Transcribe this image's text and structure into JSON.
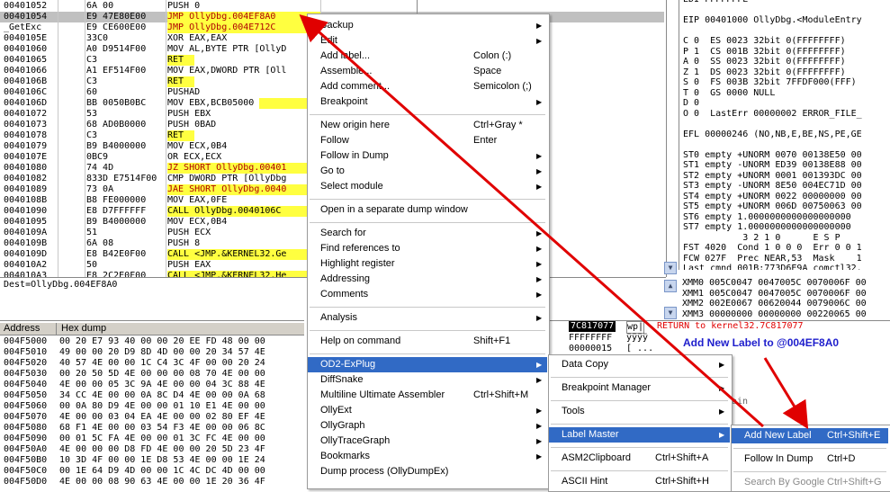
{
  "disasm": {
    "rows": [
      {
        "addr": "00401052",
        "hex": "6A 00",
        "cmd": "PUSH 0",
        "style": ""
      },
      {
        "addr": "00401054",
        "hex": "E9 47E80E00",
        "cmd": "JMP OllyDbg.004EF8A0",
        "style": "jmp-sel"
      },
      {
        "addr": "_GetExc",
        "hex": "E9 CE600E00",
        "cmd": "JMP OllyDbg.004E712C",
        "style": "jmp"
      },
      {
        "addr": "0040105E",
        "hex": "33C0",
        "cmd": "XOR EAX,EAX",
        "style": ""
      },
      {
        "addr": "00401060",
        "hex": "A0 D9514F00",
        "cmd": "MOV AL,BYTE PTR [OllyD",
        "style": ""
      },
      {
        "addr": "00401065",
        "hex": "C3",
        "cmd": "RET",
        "style": "ret"
      },
      {
        "addr": "00401066",
        "hex": "A1 EF514F00",
        "cmd": "MOV EAX,DWORD PTR [Oll",
        "style": ""
      },
      {
        "addr": "0040106B",
        "hex": "C3",
        "cmd": "RET",
        "style": "ret"
      },
      {
        "addr": "0040106C",
        "hex": "60",
        "cmd": "PUSHAD",
        "style": ""
      },
      {
        "addr": "0040106D",
        "hex": "BB 0050B0BC",
        "cmd": "MOV EBX,BCB05000",
        "style": "movhl"
      },
      {
        "addr": "00401072",
        "hex": "53",
        "cmd": "PUSH EBX",
        "style": ""
      },
      {
        "addr": "00401073",
        "hex": "68 AD0B0000",
        "cmd": "PUSH 0BAD",
        "style": ""
      },
      {
        "addr": "00401078",
        "hex": "C3",
        "cmd": "RET",
        "style": "ret"
      },
      {
        "addr": "00401079",
        "hex": "B9 B4000000",
        "cmd": "MOV ECX,0B4",
        "style": ""
      },
      {
        "addr": "0040107E",
        "hex": "0BC9",
        "cmd": "OR ECX,ECX",
        "style": ""
      },
      {
        "addr": "00401080",
        "hex": "74 4D",
        "cmd": "JZ SHORT OllyDbg.00401",
        "style": "jmp"
      },
      {
        "addr": "00401082",
        "hex": "833D E7514F00",
        "cmd": "CMP DWORD PTR [OllyDbg",
        "style": ""
      },
      {
        "addr": "00401089",
        "hex": "73 0A",
        "cmd": "JAE SHORT OllyDbg.0040",
        "style": "jmp"
      },
      {
        "addr": "0040108B",
        "hex": "B8 FE000000",
        "cmd": "MOV EAX,0FE",
        "style": ""
      },
      {
        "addr": "00401090",
        "hex": "E8 D7FFFFFF",
        "cmd": "CALL OllyDbg.0040106C",
        "style": "call"
      },
      {
        "addr": "00401095",
        "hex": "B9 B4000000",
        "cmd": "MOV ECX,0B4",
        "style": ""
      },
      {
        "addr": "0040109A",
        "hex": "51",
        "cmd": "PUSH ECX",
        "style": ""
      },
      {
        "addr": "0040109B",
        "hex": "6A 08",
        "cmd": "PUSH 8",
        "style": ""
      },
      {
        "addr": "0040109D",
        "hex": "E8 B42E0F00",
        "cmd": "CALL <JMP.&KERNEL32.Ge",
        "style": "call"
      },
      {
        "addr": "004010A2",
        "hex": "50",
        "cmd": "PUSH EAX",
        "style": ""
      },
      {
        "addr": "004010A3",
        "hex": "E8 2C2E0F00",
        "cmd": "CALL <JMP.&KERNEL32.He",
        "style": "call"
      }
    ]
  },
  "registers": {
    "rows": [
      "EDI FFFFFFFE",
      "",
      "EIP 00401000 OllyDbg.<ModuleEntry",
      "",
      "C 0  ES 0023 32bit 0(FFFFFFFF)",
      "P 1  CS 001B 32bit 0(FFFFFFFF)",
      "A 0  SS 0023 32bit 0(FFFFFFFF)",
      "Z 1  DS 0023 32bit 0(FFFFFFFF)",
      "S 0  FS 003B 32bit 7FFDF000(FFF)",
      "T 0  GS 0000 NULL",
      "D 0",
      "O 0  LastErr 00000002 ERROR_FILE_",
      "",
      "EFL 00000246 (NO,NB,E,BE,NS,PE,GE",
      "",
      "ST0 empty +UNORM 0070 00138E50 00",
      "ST1 empty -UNORM ED39 00138E88 00",
      "ST2 empty +UNORM 0001 001393DC 00",
      "ST3 empty -UNORM 8E50 004EC71D 00",
      "ST4 empty +UNORM 0022 00000000 00",
      "ST5 empty +UNORM 006D 00750063 00",
      "ST6 empty 1.0000000000000000000",
      "ST7 empty 1.0000000000000000000",
      "           3 2 1 0      E S P",
      "FST 4020  Cond 1 0 0 0  Err 0 0 1",
      "FCW 027F  Prec NEAR,53  Mask    1",
      "Last cmnd 001B:773D6E9A comctl32."
    ],
    "mmx": [
      "XMM0 005C0047 0047005C 0070006F 00",
      "XMM1 005C0047 0047005C 0070006F 00",
      "XMM2 002E0067 00620044 0079006C 00",
      "XMM3 00000000 00000000 00220065 00"
    ]
  },
  "info": {
    "text": "Dest=OllyDbg.004EF8A0"
  },
  "dump": {
    "col_address": "Address",
    "col_hex": "Hex dump",
    "rows": [
      {
        "addr": "004F5000",
        "hex": "00 20 E7 93 40 00 00 20 EE FD 48 00 00"
      },
      {
        "addr": "004F5010",
        "hex": "49 00 00 20 D9 8D 4D 00 00 20 34 57 4E"
      },
      {
        "addr": "004F5020",
        "hex": "40 57 4E 00 00 1C C4 3C 4F 00 00 20 24"
      },
      {
        "addr": "004F5030",
        "hex": "00 20 50 5D 4E 00 00 00 08 70 4E 00 00"
      },
      {
        "addr": "004F5040",
        "hex": "4E 00 00 05 3C 9A 4E 00 00 04 3C 88 4E"
      },
      {
        "addr": "004F5050",
        "hex": "34 CC 4E 00 00 0A 8C D4 4E 00 00 0A 68"
      },
      {
        "addr": "004F5060",
        "hex": "00 0A 80 D9 4E 00 00 01 10 E1 4E 00 00"
      },
      {
        "addr": "004F5070",
        "hex": "4E 00 00 03 04 EA 4E 00 00 02 80 EF 4E"
      },
      {
        "addr": "004F5080",
        "hex": "68 F1 4E 00 00 03 54 F3 4E 00 00 06 8C"
      },
      {
        "addr": "004F5090",
        "hex": "00 01 5C FA 4E 00 00 01 3C FC 4E 00 00"
      },
      {
        "addr": "004F50A0",
        "hex": "4E 00 00 00 D8 FD 4E 00 00 20 5D 23 4F"
      },
      {
        "addr": "004F50B0",
        "hex": "10 3D 4F 00 00 1E D8 53 4E 00 00 1E 24"
      },
      {
        "addr": "004F50C0",
        "hex": "00 1E 64 D9 4D 00 00 1C 4C DC 4D 00 00"
      },
      {
        "addr": "004F50D0",
        "hex": "4E 00 00 08 90 63 4E 00 00 1E 20 36 4F"
      }
    ]
  },
  "stack": {
    "top_addr": "7C817077",
    "top_ret": "wp|",
    "return_text": "RETURN to kernel32.7C817077",
    "row2": "FFFFFFFF",
    "row2b": "ÿÿÿÿ",
    "row3": "00000015",
    "row3b": "[ ...",
    "tail_text": "ain"
  },
  "annotation": {
    "text": "Add New Label to @004EF8A0",
    "color": "#1e1ecc"
  },
  "context_menu": {
    "items": [
      {
        "label": "Backup",
        "shortcut": "",
        "arrow": true
      },
      {
        "label": "Edit",
        "shortcut": "",
        "arrow": true
      },
      {
        "label": "Add label...",
        "shortcut": "Colon (:)",
        "arrow": false
      },
      {
        "label": "Assemble...",
        "shortcut": "Space",
        "arrow": false
      },
      {
        "label": "Add comment...",
        "shortcut": "Semicolon (;)",
        "arrow": false
      },
      {
        "label": "Breakpoint",
        "shortcut": "",
        "arrow": true
      },
      {
        "sep": true
      },
      {
        "label": "New origin here",
        "shortcut": "Ctrl+Gray *",
        "arrow": false
      },
      {
        "label": "Follow",
        "shortcut": "Enter",
        "arrow": false
      },
      {
        "label": "Follow in Dump",
        "shortcut": "",
        "arrow": true
      },
      {
        "label": "Go to",
        "shortcut": "",
        "arrow": true
      },
      {
        "label": "Select module",
        "shortcut": "",
        "arrow": true
      },
      {
        "sep": true
      },
      {
        "label": "Open in a separate dump window",
        "shortcut": "",
        "arrow": false
      },
      {
        "sep": true
      },
      {
        "label": "Search for",
        "shortcut": "",
        "arrow": true
      },
      {
        "label": "Find references to",
        "shortcut": "",
        "arrow": true
      },
      {
        "label": "Highlight register",
        "shortcut": "",
        "arrow": true
      },
      {
        "label": "Addressing",
        "shortcut": "",
        "arrow": true
      },
      {
        "label": "Comments",
        "shortcut": "",
        "arrow": true
      },
      {
        "sep": true
      },
      {
        "label": "Analysis",
        "shortcut": "",
        "arrow": true
      },
      {
        "sep": true
      },
      {
        "label": "Help on command",
        "shortcut": "Shift+F1",
        "arrow": false
      },
      {
        "sep": true
      },
      {
        "label": "OD2-ExPlug",
        "shortcut": "",
        "arrow": true,
        "active": true
      },
      {
        "label": "DiffSnake",
        "shortcut": "",
        "arrow": true
      },
      {
        "label": "Multiline Ultimate Assembler",
        "shortcut": "Ctrl+Shift+M",
        "arrow": false
      },
      {
        "label": "OllyExt",
        "shortcut": "",
        "arrow": true
      },
      {
        "label": "OllyGraph",
        "shortcut": "",
        "arrow": true
      },
      {
        "label": "OllyTraceGraph",
        "shortcut": "",
        "arrow": true
      },
      {
        "label": "Bookmarks",
        "shortcut": "",
        "arrow": true
      },
      {
        "label": "Dump process (OllyDumpEx)",
        "shortcut": "",
        "arrow": false
      }
    ]
  },
  "submenu1": {
    "items": [
      {
        "label": "Data Copy",
        "shortcut": "",
        "arrow": true
      },
      {
        "sep": true
      },
      {
        "label": "Breakpoint Manager",
        "shortcut": "",
        "arrow": true
      },
      {
        "sep": true
      },
      {
        "label": "Tools",
        "shortcut": "",
        "arrow": true
      },
      {
        "sep": true
      },
      {
        "label": "Label Master",
        "shortcut": "",
        "arrow": true,
        "active": true
      },
      {
        "sep": true
      },
      {
        "label": "ASM2Clipboard",
        "shortcut": "Ctrl+Shift+A",
        "arrow": false
      },
      {
        "sep": true
      },
      {
        "label": "ASCII Hint",
        "shortcut": "Ctrl+Shift+H",
        "arrow": false
      }
    ]
  },
  "submenu2": {
    "items": [
      {
        "label": "Add New Label",
        "shortcut": "Ctrl+Shift+E",
        "active": true
      },
      {
        "sep": true
      },
      {
        "label": "Follow In Dump",
        "shortcut": "Ctrl+D"
      },
      {
        "sep": true
      },
      {
        "label": "Search By Google",
        "shortcut": "Ctrl+Shift+G",
        "grey": true
      }
    ]
  },
  "colors": {
    "menu_highlight": "#316ac5",
    "arrow_red": "#e00000",
    "jmp_yellow": "#ffff40"
  }
}
